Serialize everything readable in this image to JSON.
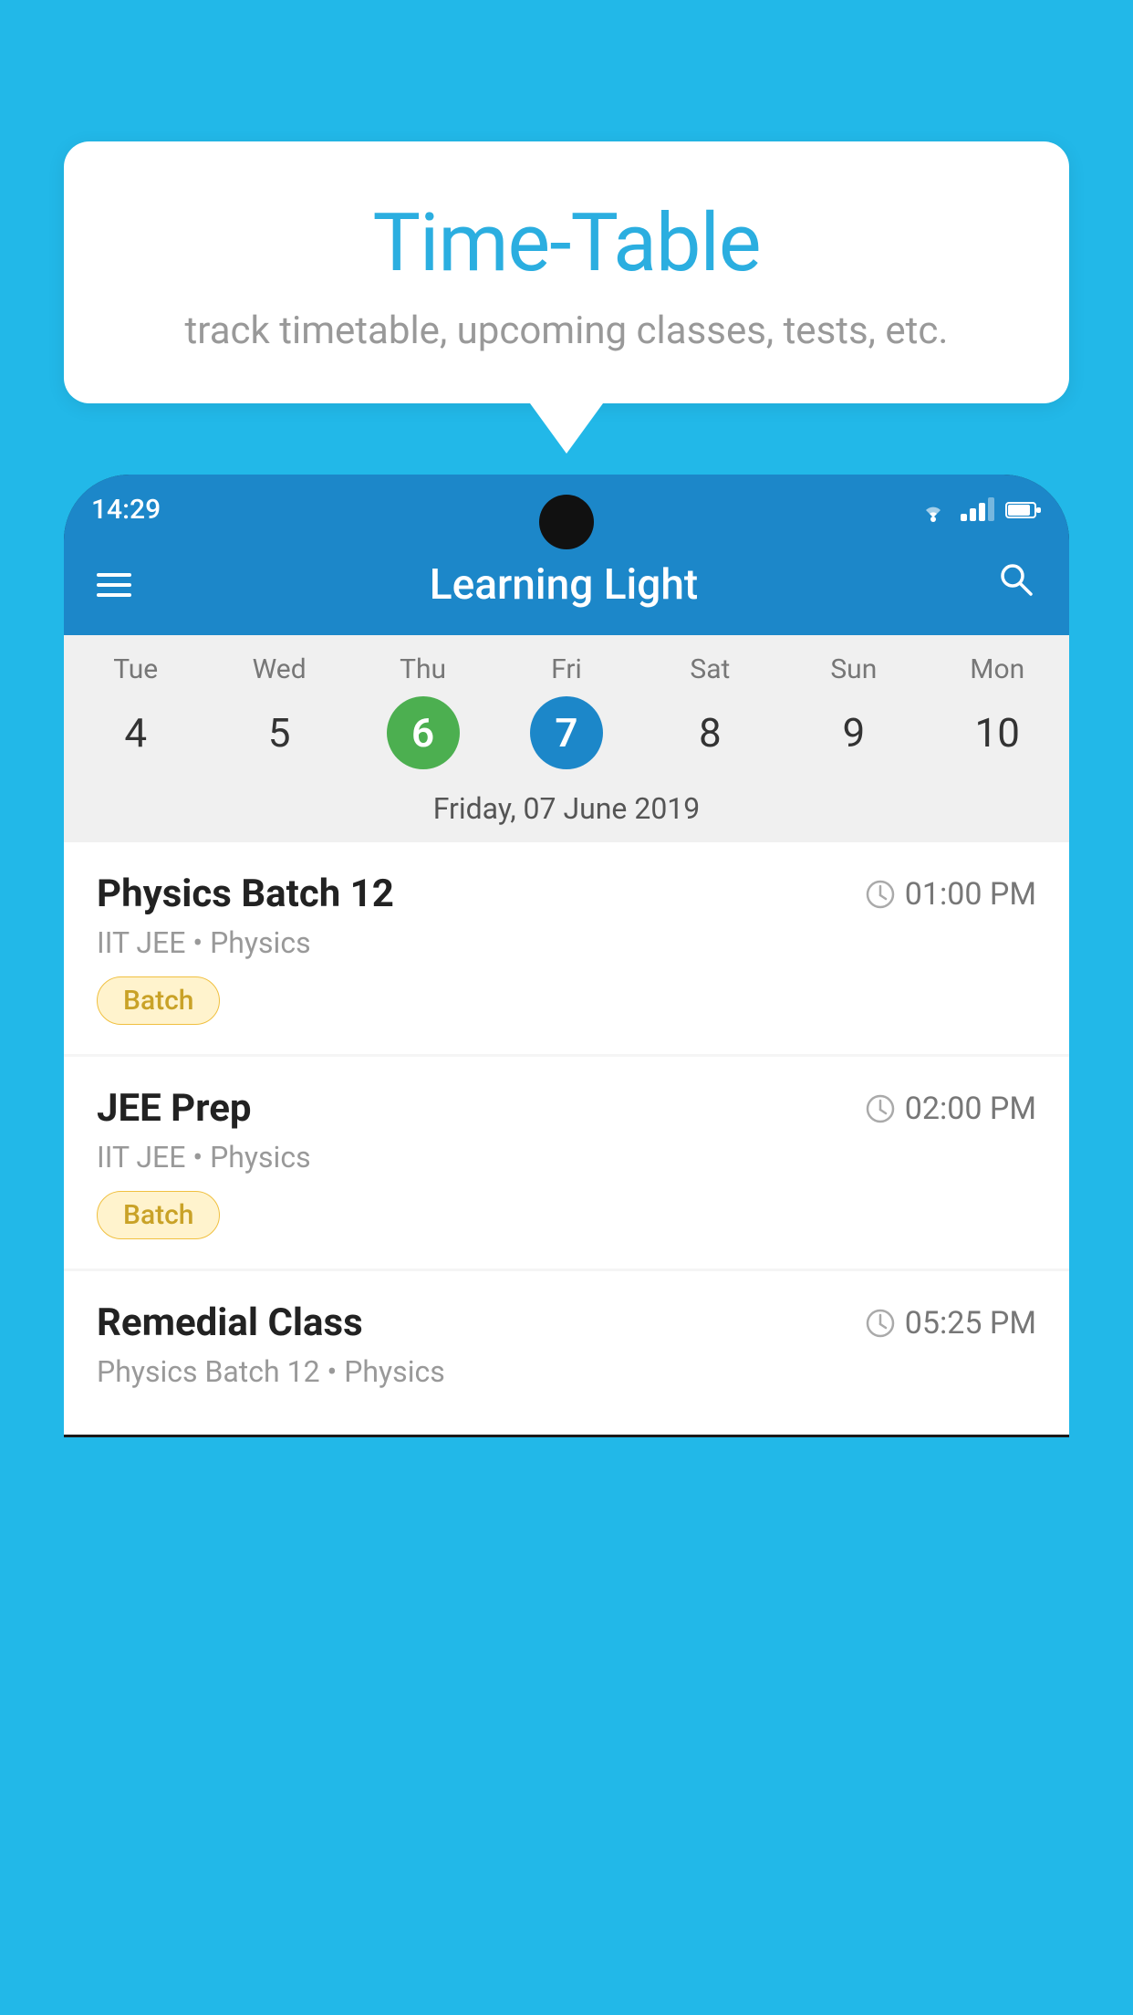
{
  "background_color": "#22B8E8",
  "speech_bubble": {
    "title": "Time-Table",
    "subtitle": "track timetable, upcoming classes, tests, etc."
  },
  "phone": {
    "status_bar": {
      "time": "14:29"
    },
    "app_bar": {
      "title": "Learning Light"
    },
    "calendar": {
      "days": [
        {
          "name": "Tue",
          "number": "4",
          "state": "normal"
        },
        {
          "name": "Wed",
          "number": "5",
          "state": "normal"
        },
        {
          "name": "Thu",
          "number": "6",
          "state": "today"
        },
        {
          "name": "Fri",
          "number": "7",
          "state": "selected"
        },
        {
          "name": "Sat",
          "number": "8",
          "state": "normal"
        },
        {
          "name": "Sun",
          "number": "9",
          "state": "normal"
        },
        {
          "name": "Mon",
          "number": "10",
          "state": "normal"
        }
      ],
      "selected_date_label": "Friday, 07 June 2019"
    },
    "schedule": [
      {
        "title": "Physics Batch 12",
        "time": "01:00 PM",
        "subtitle": "IIT JEE • Physics",
        "badge": "Batch"
      },
      {
        "title": "JEE Prep",
        "time": "02:00 PM",
        "subtitle": "IIT JEE • Physics",
        "badge": "Batch"
      },
      {
        "title": "Remedial Class",
        "time": "05:25 PM",
        "subtitle": "Physics Batch 12 • Physics",
        "badge": null
      }
    ]
  }
}
